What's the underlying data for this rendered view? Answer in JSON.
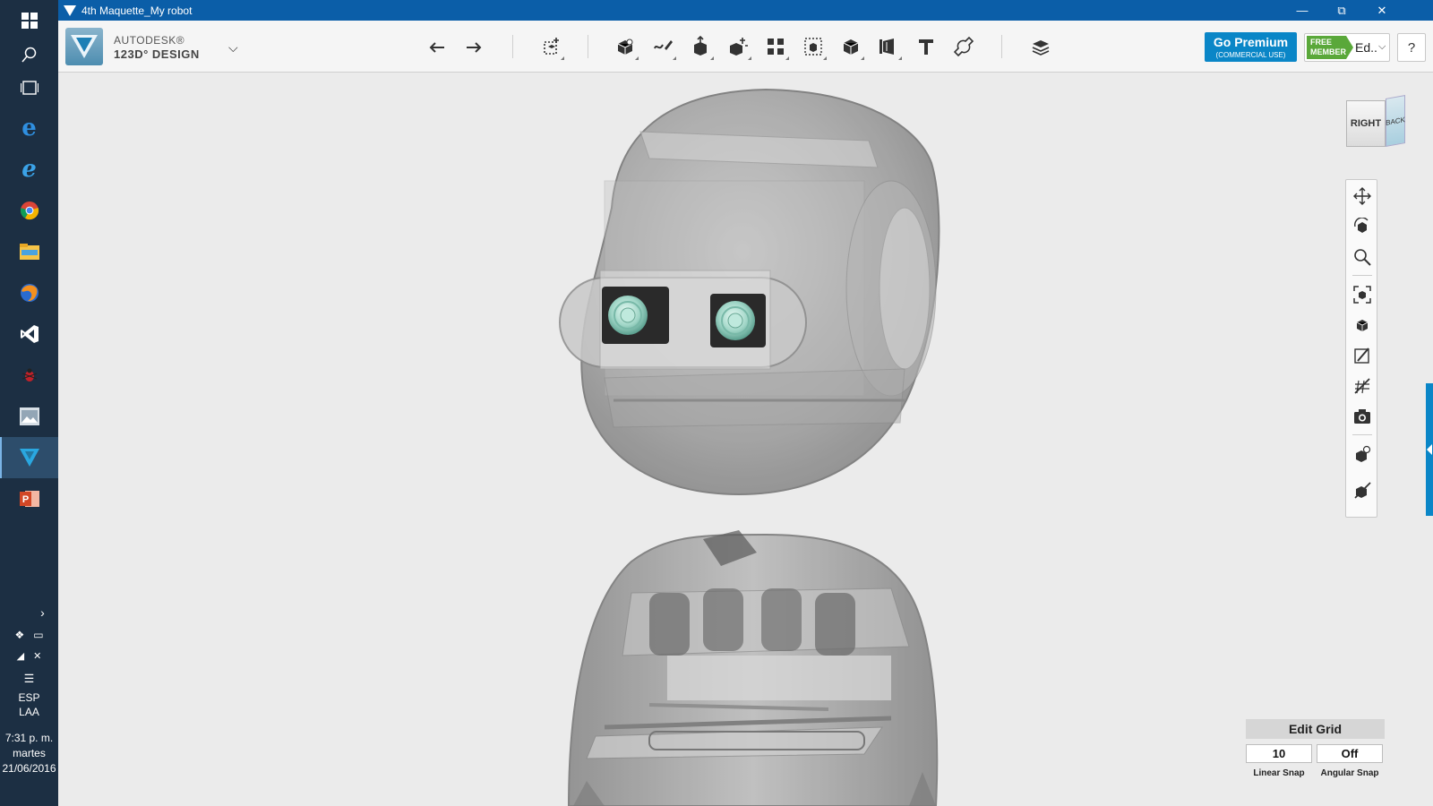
{
  "window": {
    "title": "4th Maquette_My robot"
  },
  "brand": {
    "line1": "AUTODESK®",
    "line2": "123D° DESIGN"
  },
  "toolbar": {
    "tools": [
      {
        "icon": "undo-icon"
      },
      {
        "icon": "redo-icon"
      },
      {
        "icon": "transform-icon"
      },
      {
        "icon": "primitives-icon"
      },
      {
        "icon": "sketch-icon"
      },
      {
        "icon": "construct-icon"
      },
      {
        "icon": "modify-icon"
      },
      {
        "icon": "pattern-icon"
      },
      {
        "icon": "group-icon"
      },
      {
        "icon": "combine-icon"
      },
      {
        "icon": "measure-icon"
      },
      {
        "icon": "text-icon"
      },
      {
        "icon": "snap-icon"
      },
      {
        "icon": "material-icon"
      }
    ]
  },
  "account": {
    "premium_main": "Go Premium",
    "premium_sub": "(COMMERCIAL USE)",
    "free_badge_line1": "FREE",
    "free_badge_line2": "MEMBER",
    "user_label": "Ed..",
    "help_label": "?"
  },
  "viewcube": {
    "front": "RIGHT",
    "side": "BACK"
  },
  "grid": {
    "title": "Edit Grid",
    "linear_value": "10",
    "angular_value": "Off",
    "linear_label": "Linear Snap",
    "angular_label": "Angular Snap"
  },
  "tray": {
    "lang1": "ESP",
    "lang2": "LAA",
    "time": "7:31 p. m.",
    "day": "martes",
    "date": "21/06/2016"
  },
  "colors": {
    "titlebar": "#0b5ea8",
    "taskbar": "#1c2f43",
    "accent": "#0a86c7",
    "free_green": "#5aa83a"
  }
}
